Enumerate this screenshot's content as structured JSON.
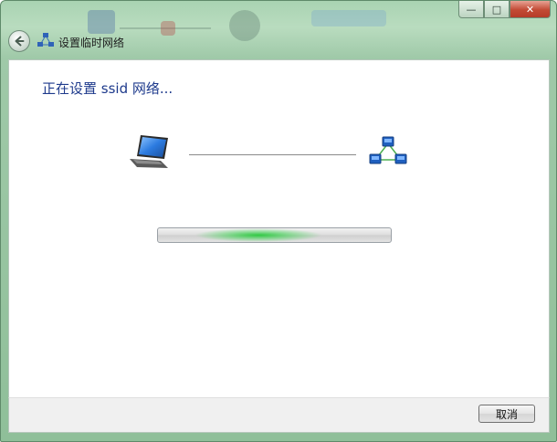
{
  "window": {
    "title": "设置临时网络",
    "caption_buttons": {
      "minimize": "—",
      "maximize": "□",
      "close": "✕"
    }
  },
  "main": {
    "heading": "正在设置 ssid 网络...",
    "progress_state": "indeterminate"
  },
  "footer": {
    "cancel_label": "取消"
  },
  "icons": {
    "back": "back-arrow-icon",
    "title": "network-icon",
    "computer": "laptop-icon",
    "target": "ad-hoc-network-icon"
  },
  "colors": {
    "heading_text": "#1e3a8c",
    "glass_frame": "#9fc9a8",
    "progress_glow": "#28c83c"
  }
}
